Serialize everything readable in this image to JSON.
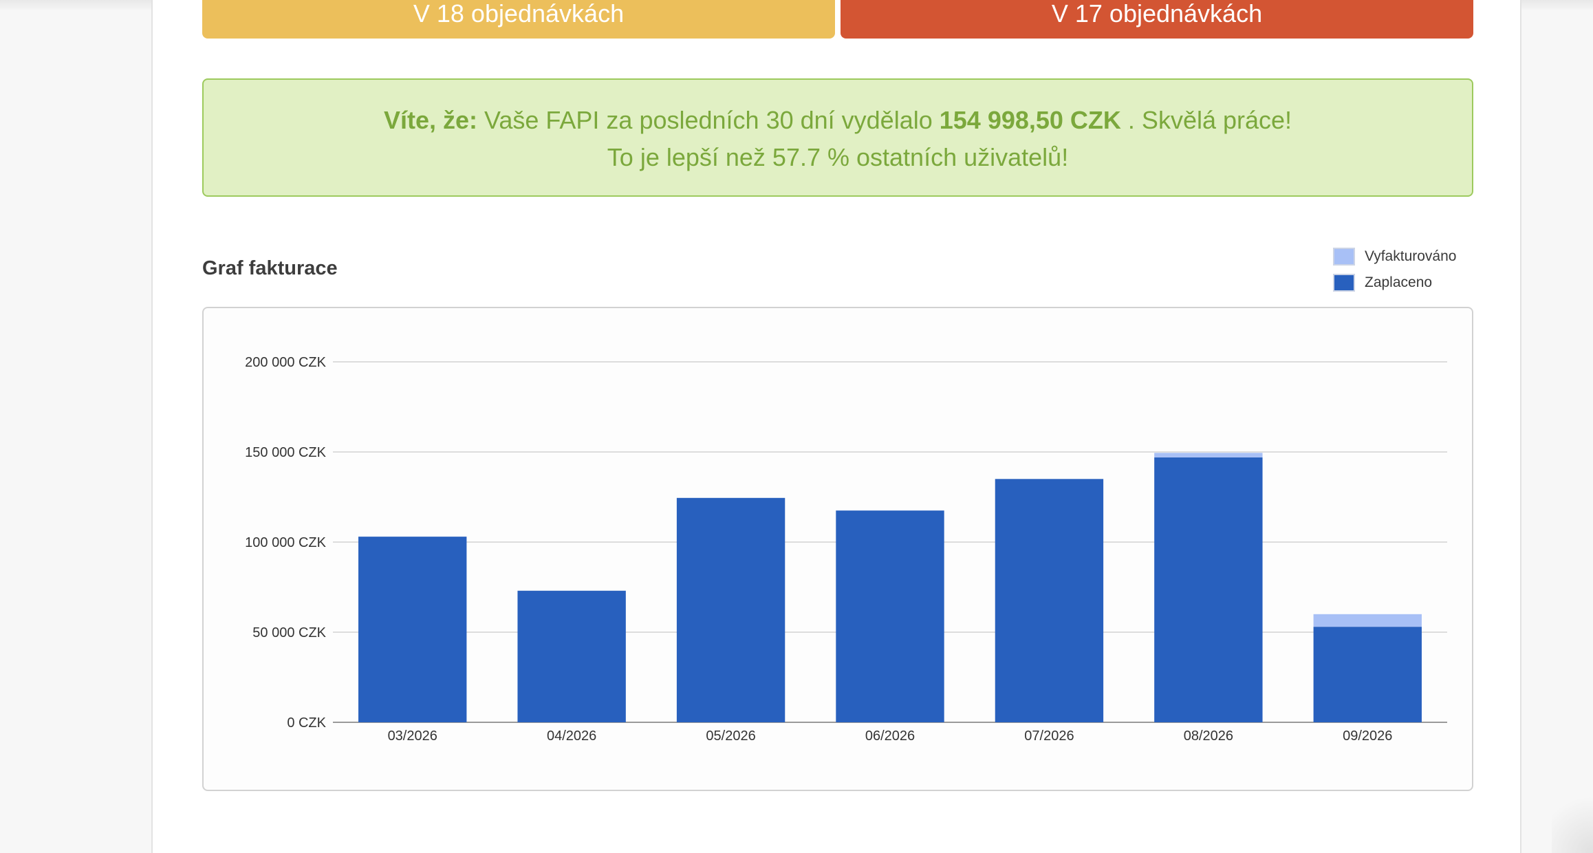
{
  "stats": {
    "yellow_label": "V 18 objednávkách",
    "red_label": "V 17 objednávkách"
  },
  "info": {
    "lead": "Víte, že:",
    "text_before": " Vaše FAPI za posledních 30 dní vydělalo ",
    "amount": "154 998,50 CZK",
    "text_after": " . Skvělá práce!",
    "line2": "To je lepší než 57.7 % ostatních uživatelů!"
  },
  "colors": {
    "accent_yellow": "#ecbf5b",
    "accent_red": "#d35533",
    "info_text": "#7ba83c",
    "paid": "#2860be",
    "invoiced": "#a8c0f6"
  },
  "chart_data": {
    "type": "bar",
    "stacked": true,
    "title": "Graf fakturace",
    "categories": [
      "03/2026",
      "04/2026",
      "05/2026",
      "06/2026",
      "07/2026",
      "08/2026",
      "09/2026"
    ],
    "series": [
      {
        "name": "Zaplaceno",
        "color": "#2860be",
        "values": [
          103000,
          73000,
          124500,
          117500,
          135000,
          147000,
          53000
        ]
      },
      {
        "name": "Vyfakturováno",
        "color": "#a8c0f6",
        "values": [
          0,
          0,
          0,
          0,
          0,
          2500,
          7000
        ]
      }
    ],
    "legend": [
      "Vyfakturováno",
      "Zaplaceno"
    ],
    "legend_position": "top-right",
    "ylim": [
      0,
      200000
    ],
    "yticks": [
      0,
      50000,
      100000,
      150000,
      200000
    ],
    "ytick_labels": [
      "0 CZK",
      "50 000 CZK",
      "100 000 CZK",
      "150 000 CZK",
      "200 000 CZK"
    ],
    "grid": true
  }
}
